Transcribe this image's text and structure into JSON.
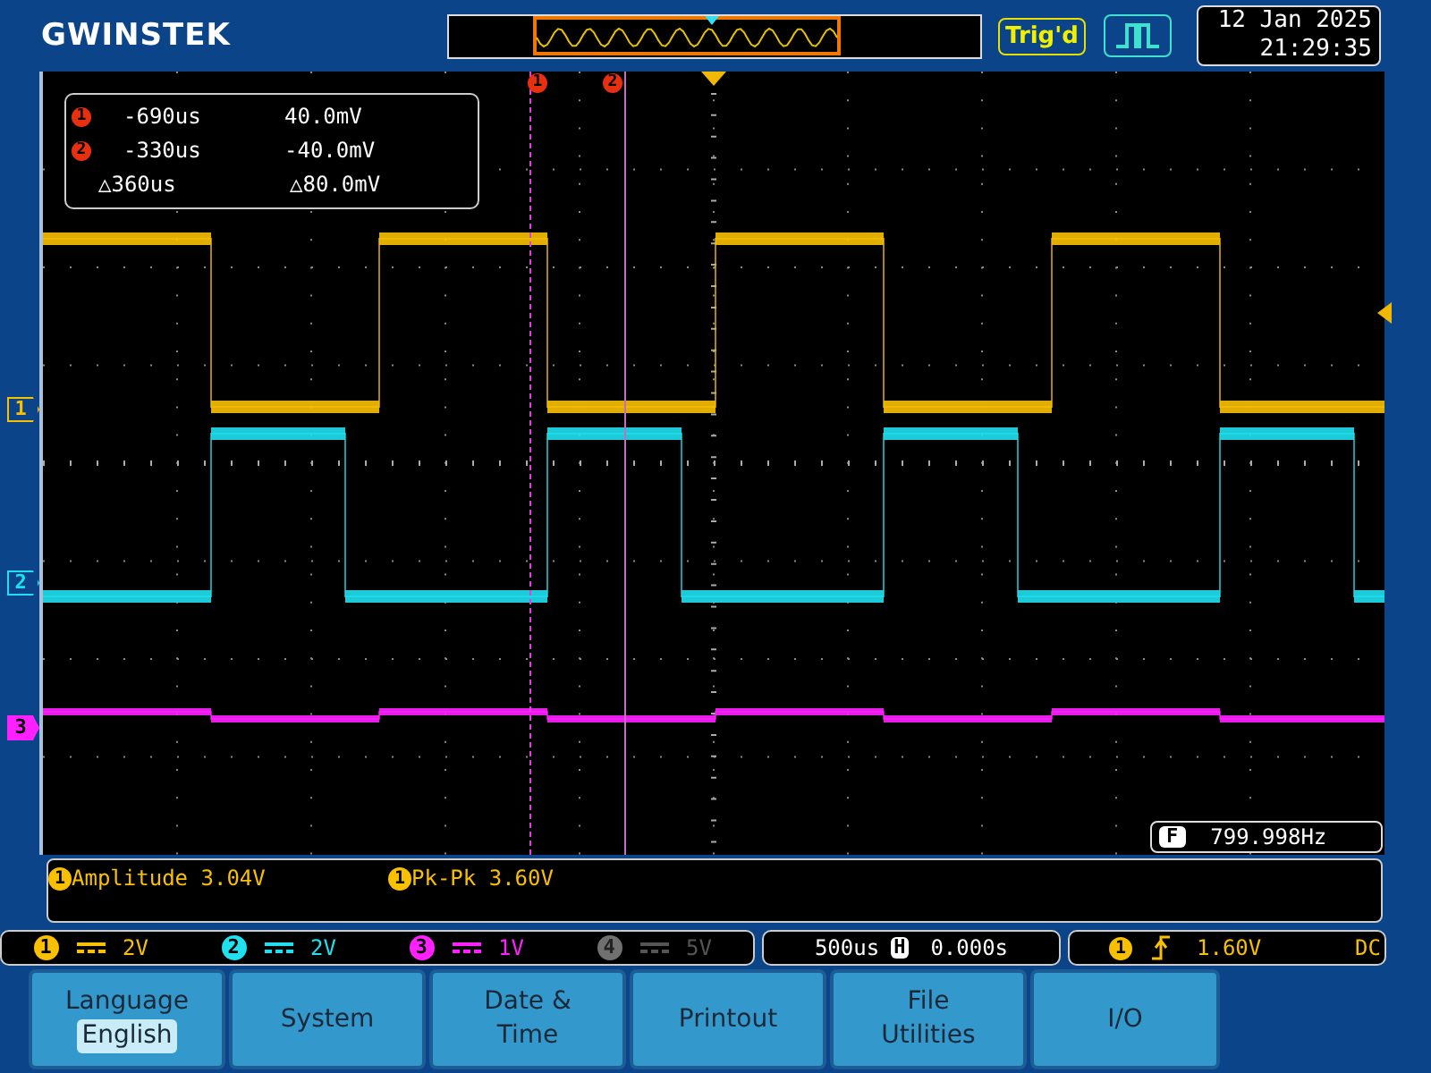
{
  "brand": "GWINSTEK",
  "acquisition": {
    "status": "Trig'd"
  },
  "clock": {
    "date": "12 Jan 2025",
    "time": "21:29:35"
  },
  "cursor_readout": [
    {
      "marker": "1",
      "time": "-690us",
      "voltage": "40.0mV"
    },
    {
      "marker": "2",
      "time": "-330us",
      "voltage": "-40.0mV"
    }
  ],
  "cursor_delta": {
    "time": "△360us",
    "voltage": "△80.0mV"
  },
  "cursor_markers": [
    "1",
    "2"
  ],
  "channel_markers": [
    {
      "label": "1",
      "color": "#f8c000"
    },
    {
      "label": "2",
      "color": "#20e0f0"
    },
    {
      "label": "3",
      "color": "#ff20ff"
    }
  ],
  "frequency": {
    "badge": "F",
    "value": "799.998Hz"
  },
  "measurements": [
    {
      "channel": "1",
      "text": "Amplitude 3.04V"
    },
    {
      "channel": "1",
      "text": "Pk-Pk 3.60V"
    }
  ],
  "channels": [
    {
      "number": "1",
      "scale": "2V",
      "color": "#f8c000",
      "enabled": true
    },
    {
      "number": "2",
      "scale": "2V",
      "color": "#20e0f0",
      "enabled": true
    },
    {
      "number": "3",
      "scale": "1V",
      "color": "#ff20ff",
      "enabled": true
    },
    {
      "number": "4",
      "scale": "5V",
      "color": "#707070",
      "enabled": false
    }
  ],
  "timebase": {
    "scale": "500us",
    "mode_badge": "H",
    "position": "0.000s"
  },
  "trigger": {
    "source": "1",
    "level": "1.60V",
    "coupling": "DC"
  },
  "menu": [
    {
      "label": "Language",
      "value": "English"
    },
    {
      "label": "System"
    },
    {
      "label": "Date & Time"
    },
    {
      "label": "Printout"
    },
    {
      "label": "File Utilities"
    },
    {
      "label": "I/O"
    }
  ]
}
